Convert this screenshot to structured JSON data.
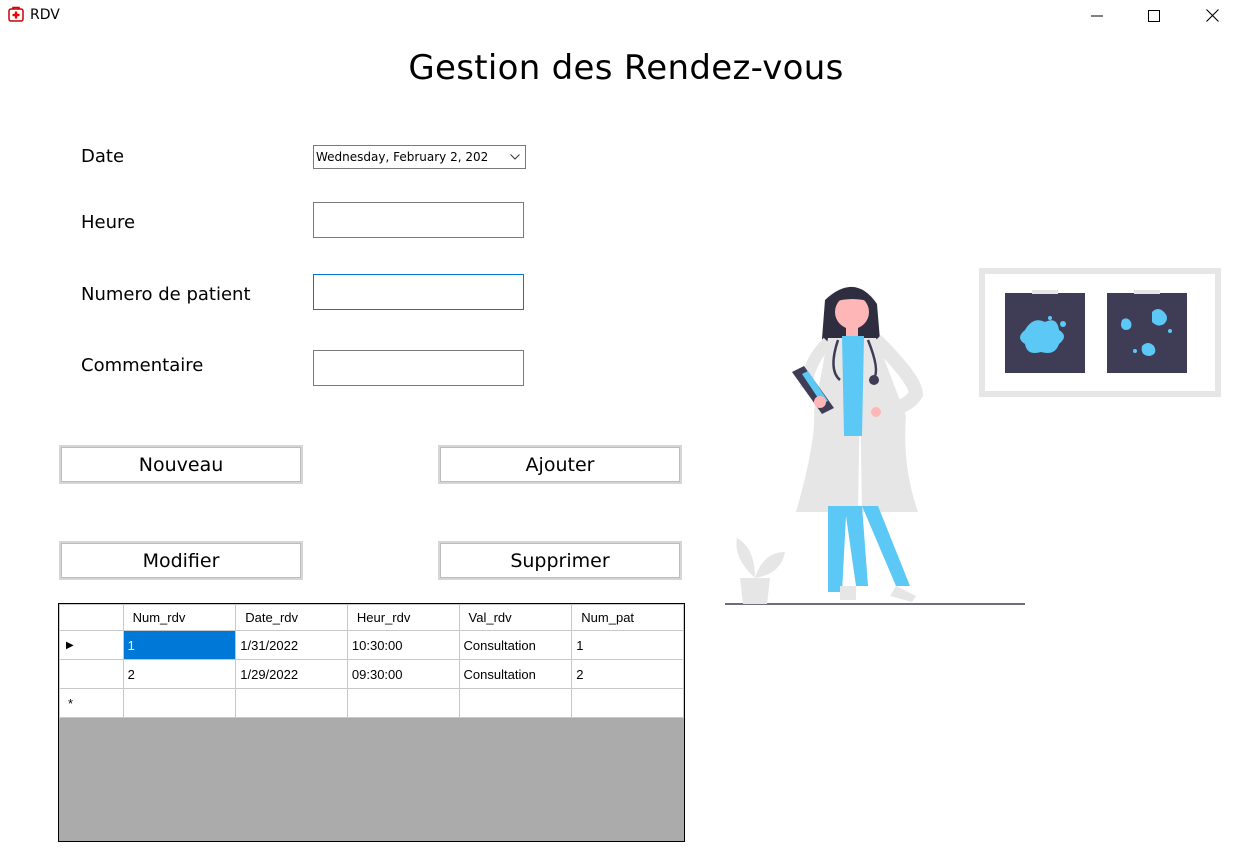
{
  "window": {
    "title": "RDV",
    "icon": "medical-cross-icon",
    "controls": [
      "minimize-icon",
      "maximize-icon",
      "close-icon"
    ]
  },
  "heading": "Gestion des Rendez-vous",
  "form": {
    "date_label": "Date",
    "date_value": "Wednesday,   February    2, 202",
    "heure_label": "Heure",
    "heure_value": "",
    "patient_label": "Numero de patient",
    "patient_value": "",
    "commentaire_label": "Commentaire",
    "commentaire_value": ""
  },
  "buttons": {
    "nouveau": "Nouveau",
    "ajouter": "Ajouter",
    "modifier": "Modifier",
    "supprimer": "Supprimer"
  },
  "grid": {
    "columns": [
      "Num_rdv",
      "Date_rdv",
      "Heur_rdv",
      "Val_rdv",
      "Num_pat"
    ],
    "rows": [
      [
        "1",
        "1/31/2022",
        "10:30:00",
        "Consultation",
        "1"
      ],
      [
        "2",
        "1/29/2022",
        "09:30:00",
        "Consultation",
        "2"
      ]
    ],
    "current_row_marker": "▶",
    "new_row_marker": "*"
  },
  "colors": {
    "accent": "#0078d7",
    "illustration_blue": "#5cc8f5",
    "illustration_dark": "#3f3d56",
    "grid_background": "#ababab"
  }
}
